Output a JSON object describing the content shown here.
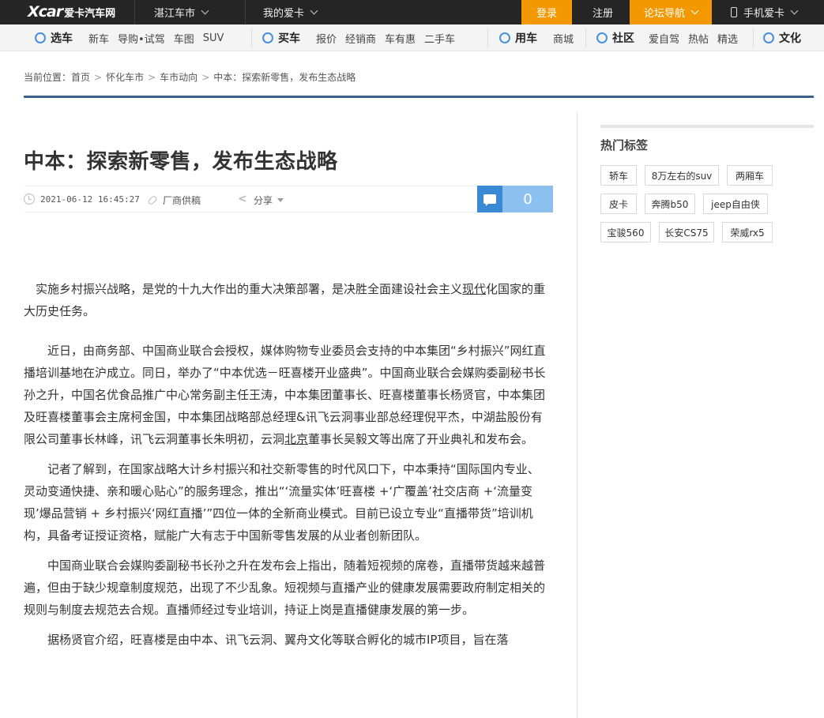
{
  "topbar": {
    "logo_latin": "Xcar",
    "logo_cn": "爱卡汽车网",
    "city": "湛江车市",
    "my_xcar": "我的爱卡",
    "login": "登录",
    "register": "注册",
    "forum_nav": "论坛导航",
    "mobile": "手机爱卡",
    "colors": {
      "bar": "#252525",
      "orange": "#f39800"
    }
  },
  "nav": {
    "groups": [
      {
        "label": "选车",
        "icon": "car-select-icon",
        "links": [
          "新车",
          "导购•试驾",
          "车图",
          "SUV"
        ]
      },
      {
        "label": "买车",
        "icon": "yuan-icon",
        "links": [
          "报价",
          "经销商",
          "车有惠",
          "二手车"
        ]
      },
      {
        "label": "用车",
        "icon": "wrench-icon",
        "links": [
          "商城"
        ]
      },
      {
        "label": "社区",
        "icon": "community-icon",
        "links": [
          "爱自驾",
          "热帖",
          "精选"
        ]
      },
      {
        "label": "文化",
        "icon": "culture-icon",
        "links": []
      }
    ]
  },
  "breadcrumb": {
    "prefix": "当前位置：",
    "items": [
      "首页",
      "怀化车市",
      "车市动向",
      "中本：探索新零售，发布生态战略"
    ]
  },
  "article": {
    "title": "中本：探索新零售，发布生态战略",
    "datetime": "2021-06-12 16:45:27",
    "source": "厂商供稿",
    "share": "分享",
    "comment_count": "0",
    "paragraphs": [
      {
        "pre": "实施乡村振兴战略，是党的十九大作出的重大决策部署，是决胜全面建设社会主义",
        "link": "现代",
        "post": "化国家的重大历史任务。"
      },
      {
        "pre": "近日，由商务部、中国商业联合会授权，媒体购物专业委员会支持的中本集团“乡村振兴”网红直播培训基地在沪成立。同日，举办了“中本优选－旺喜楼开业盛典”。中国商业联合会媒购委副秘书长孙之升，中国名优食品推广中心常务副主任王涛，中本集团董事长、旺喜楼董事长杨贤官，中本集团及旺喜楼董事会主席柯金国，中本集团战略部总经理&讯飞云洞事业部总经理倪平杰，中湖盐股份有限公司董事长林峰，讯飞云洞董事长朱明初，云洞",
        "link": "北京",
        "post": "董事长吴毅文等出席了开业典礼和发布会。"
      },
      {
        "pre": "记者了解到，在国家战略大计乡村振兴和社交新零售的时代风口下，中本秉持“国际国内专业、灵动变通快捷、亲和暖心贴心”的服务理念，推出“‘流量实体’旺喜楼 +‘广覆盖’社交店商 +‘流量变现’爆品营销 + 乡村振兴‘网红直播’”四位一体的全新商业模式。目前已设立专业“直播带货”培训机构，具备考证授证资格，赋能广大有志于中国新零售发展的从业者创新团队。",
        "link": "",
        "post": ""
      },
      {
        "pre": "中国商业联合会媒购委副秘书长孙之升在发布会上指出，随着短视频的席卷，直播带货越来越普遍，但由于缺少规章制度规范，出现了不少乱象。短视频与直播产业的健康发展需要政府制定相关的规则与制度去规范去合规。直播师经过专业培训，持证上岗是直播健康发展的第一步。",
        "link": "",
        "post": ""
      },
      {
        "pre": "据杨贤官介绍，旺喜楼是由中本、讯飞云洞、翼舟文化等联合孵化的城市IP项目，旨在落",
        "link": "",
        "post": ""
      }
    ]
  },
  "sidebar": {
    "title": "热门标签",
    "tags": [
      "轿车",
      "8万左右的suv",
      "两厢车",
      "皮卡",
      "奔腾b50",
      "jeep自由侠",
      "宝骏560",
      "长安CS75",
      "荣威rx5"
    ]
  }
}
